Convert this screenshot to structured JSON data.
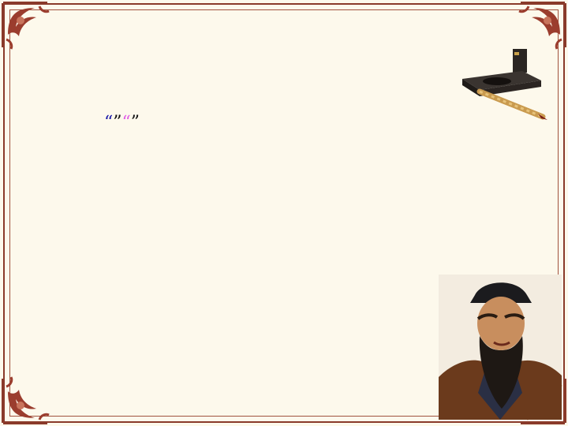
{
  "slide": {
    "title": "",
    "paragraph": {
      "lead": "",
      "quote_blue_open": "“",
      "quote_blue": "",
      "quote_blue_close": "”",
      "middle": "",
      "quote_pink_open": "“",
      "quote_pink": "",
      "quote_pink_close": "”",
      "tail": ""
    }
  },
  "colors": {
    "background": "#fdf9ec",
    "frame": "#8a3a2a",
    "quote_blue": "#1a1aa8",
    "quote_pink": "#e060e6",
    "text": "#111111"
  },
  "images": {
    "inkstone": "inkstone-brush-illustration",
    "portrait": "confucius-portrait"
  }
}
